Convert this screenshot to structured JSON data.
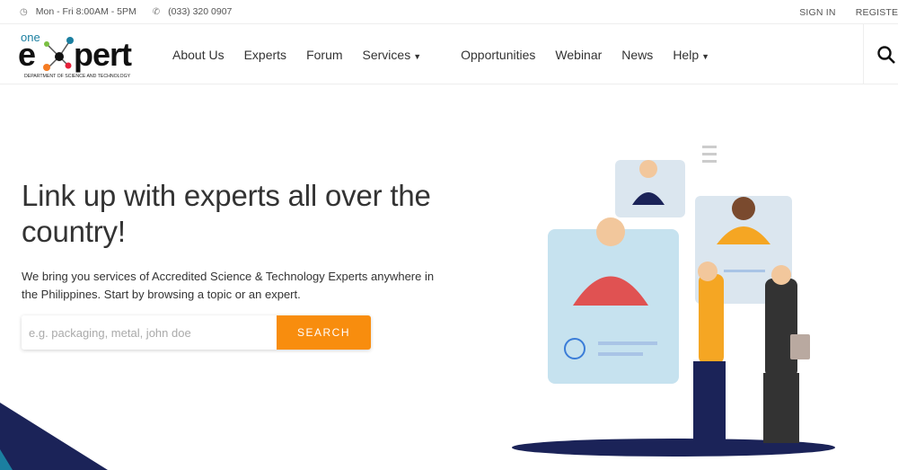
{
  "topbar": {
    "hours": "Mon - Fri 8:00AM - 5PM",
    "phone": "(033) 320 0907",
    "sign_in": "SIGN IN",
    "register": "REGISTER"
  },
  "logo": {
    "text": "one expert",
    "tagline": "DEPARTMENT OF SCIENCE AND TECHNOLOGY"
  },
  "nav": {
    "items": [
      {
        "label": "About Us"
      },
      {
        "label": "Experts"
      },
      {
        "label": "Forum"
      },
      {
        "label": "Services",
        "dropdown": true
      },
      {
        "label": "Opportunities"
      },
      {
        "label": "Webinar"
      },
      {
        "label": "News"
      },
      {
        "label": "Help",
        "dropdown": true
      }
    ]
  },
  "hero": {
    "title": "Link up with experts all over the country!",
    "subtitle": "We bring you services of Accredited Science & Technology Experts anywhere in the Philippines. Start by browsing a topic or an expert.",
    "search_placeholder": "e.g. packaging, metal, john doe",
    "search_value": "",
    "search_button": "SEARCH"
  },
  "colors": {
    "accent": "#f88d0e",
    "navy": "#1b2358",
    "teal": "#1b7fa0"
  }
}
